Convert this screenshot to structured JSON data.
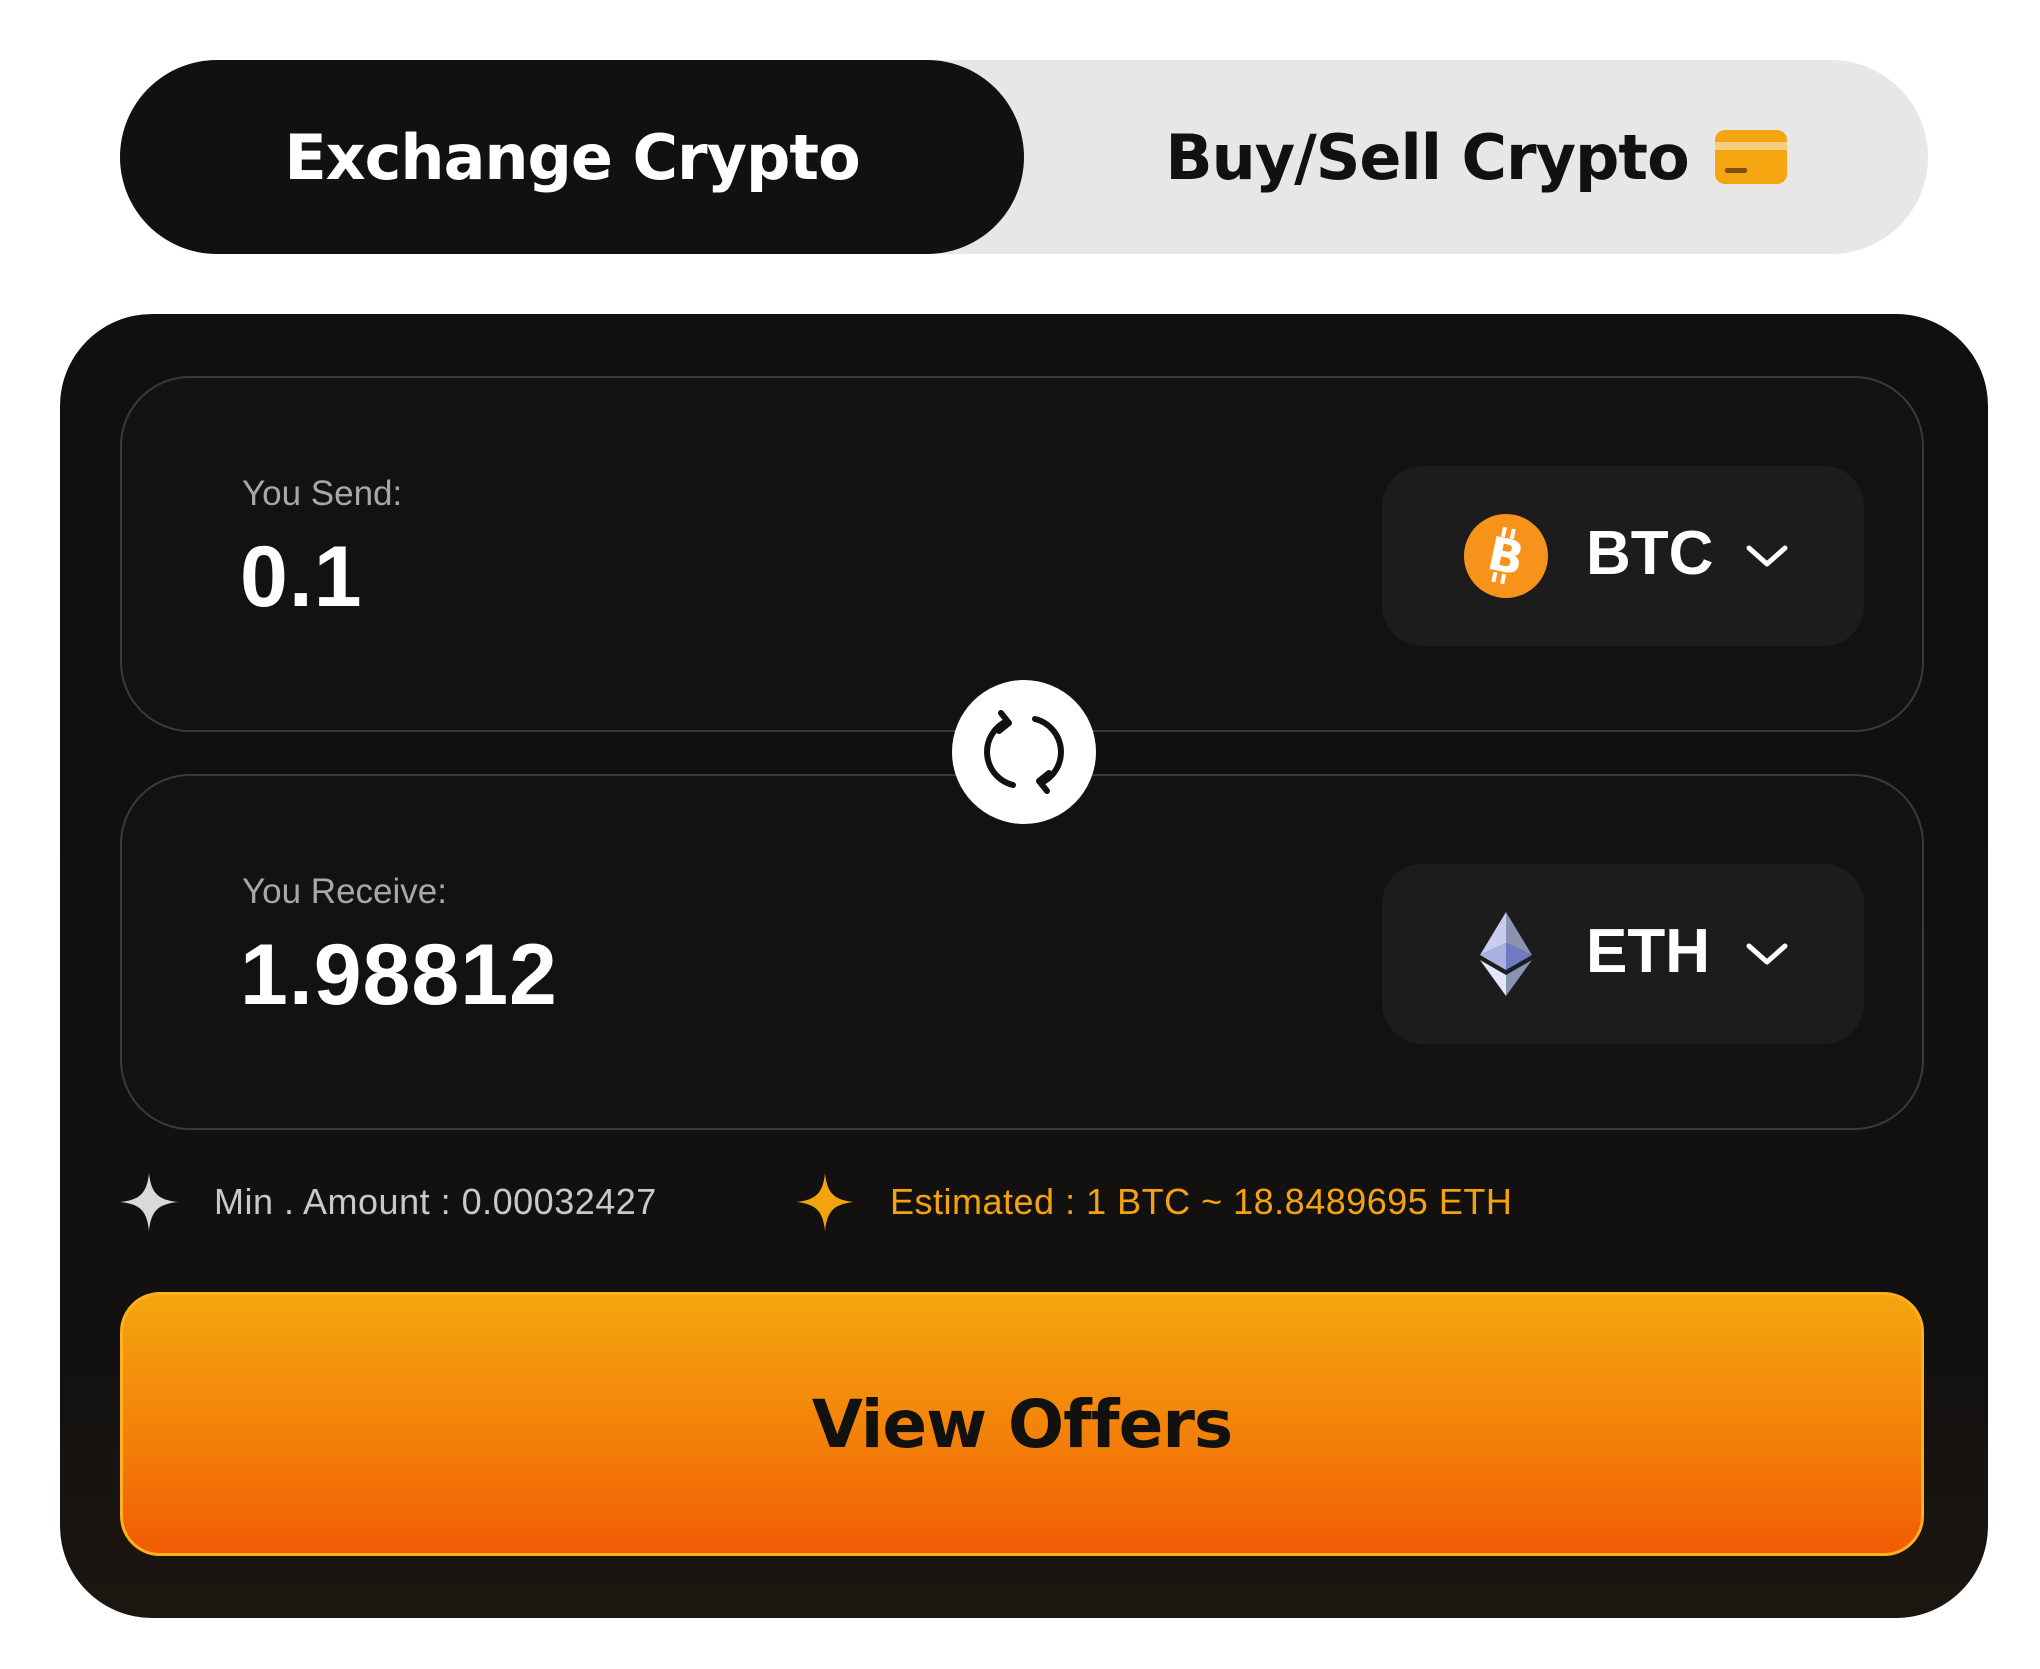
{
  "tabs": {
    "exchange_label": "Exchange Crypto",
    "buy_sell_label": "Buy/Sell Crypto",
    "active": "exchange"
  },
  "send": {
    "label": "You Send:",
    "amount": "0.1",
    "currency": "BTC",
    "icon": "bitcoin-icon"
  },
  "receive": {
    "label": "You Receive:",
    "amount": "1.98812",
    "currency": "ETH",
    "icon": "ethereum-icon"
  },
  "info": {
    "min_amount": "Min . Amount : 0.00032427",
    "estimated": "Estimated : 1 BTC ~ 18.8489695 ETH"
  },
  "cta": {
    "label": "View Offers"
  },
  "colors": {
    "accent": "#f5a20f",
    "cta_top": "#f5a60f",
    "cta_bottom": "#f15b04",
    "bitcoin": "#f7931a",
    "card_bg": "#111110",
    "tab_inactive_bg": "#e8e7e5"
  }
}
